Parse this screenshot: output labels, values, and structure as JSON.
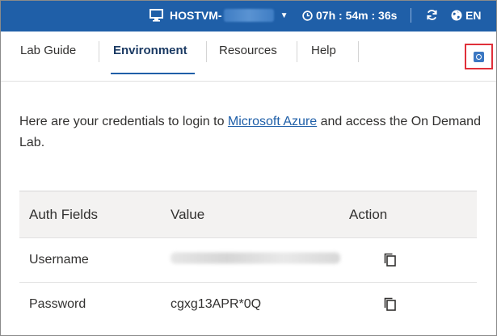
{
  "topbar": {
    "vm_name": "HOSTVM-",
    "timer": "07h : 54m : 36s",
    "language": "EN",
    "icons": {
      "monitor": "monitor-icon",
      "clock": "clock-icon",
      "refresh": "refresh-icon",
      "globe": "globe-icon",
      "caret": "caret-down-icon"
    },
    "bg_color": "#1f5fa8"
  },
  "tabs": [
    {
      "label": "Lab Guide",
      "active": false
    },
    {
      "label": "Environment",
      "active": true
    },
    {
      "label": "Resources",
      "active": false
    },
    {
      "label": "Help",
      "active": false
    }
  ],
  "expand_icon": "expand-icon",
  "intro": {
    "text_before": "Here are your credentials to login to ",
    "link": "Microsoft Azure",
    "text_after": " and access the On Demand Lab."
  },
  "credentials": {
    "headers": {
      "field": "Auth Fields",
      "value": "Value",
      "action": "Action"
    },
    "rows": [
      {
        "field": "Username",
        "value": "",
        "action_icon": "copy-icon"
      },
      {
        "field": "Password",
        "value": "cgxg13APR*0Q",
        "action_icon": "copy-icon"
      }
    ]
  }
}
